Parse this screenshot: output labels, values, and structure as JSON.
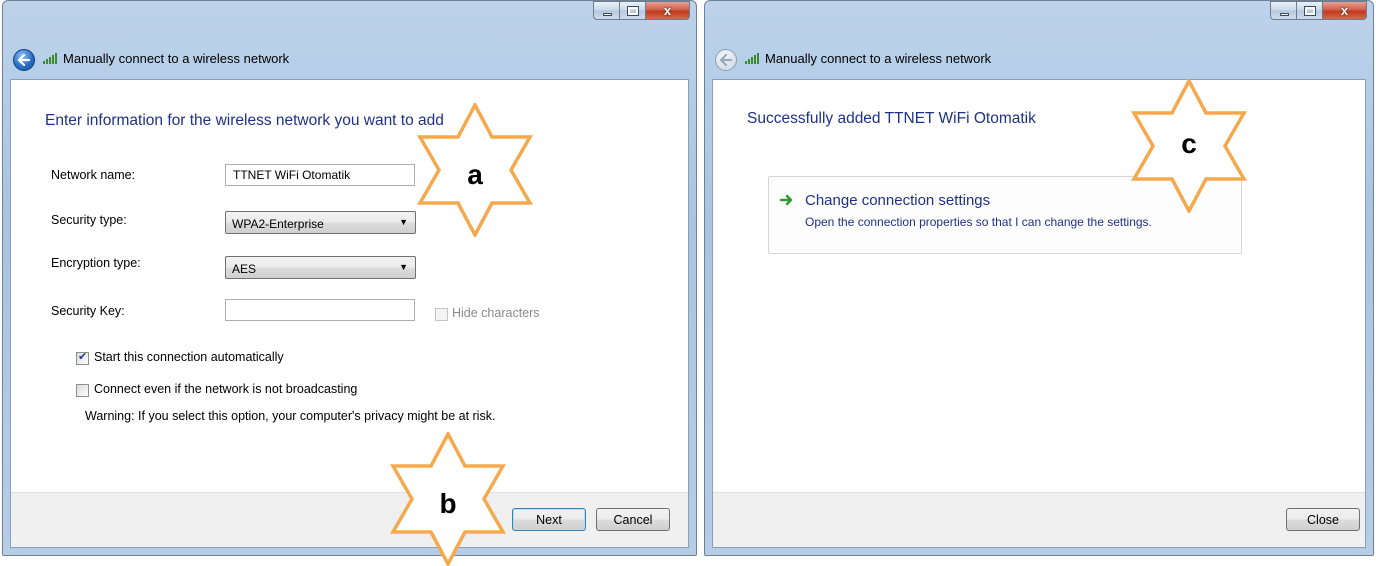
{
  "left_window": {
    "header_title": "Manually connect to a wireless network",
    "main_instruction": "Enter information for the wireless network you want to add",
    "network_name_label": "Network name:",
    "network_name_value": "TTNET WiFi Otomatik",
    "security_type_label": "Security type:",
    "security_type_value": "WPA2-Enterprise",
    "encryption_type_label": "Encryption type:",
    "encryption_type_value": "AES",
    "security_key_label": "Security Key:",
    "security_key_value": "",
    "hide_characters_label": "Hide characters",
    "start_auto_label": "Start this connection automatically",
    "connect_even_label": "Connect even if the network is not broadcasting",
    "warning_text": "Warning: If you select this option, your computer's privacy might be at risk.",
    "next_label": "Next",
    "cancel_label": "Cancel",
    "close_glyph": "x"
  },
  "right_window": {
    "header_title": "Manually connect to a wireless network",
    "success_title": "Successfully added TTNET WiFi Otomatik",
    "link_title": "Change connection settings",
    "link_description": "Open the connection properties so that I can change the settings.",
    "close_label": "Close",
    "close_glyph": "x"
  },
  "annotations": {
    "a": "a",
    "b": "b",
    "c": "c"
  },
  "colors": {
    "instruction_blue": "#1e3287",
    "star_orange": "#f5a94e",
    "close_red": "#c2391d"
  },
  "icons": [
    "back-arrow-icon",
    "wireless-signal-icon",
    "minimize-icon",
    "maximize-icon",
    "close-icon",
    "dropdown-arrow-icon",
    "checkmark-icon",
    "green-arrow-icon",
    "star-annotation"
  ]
}
